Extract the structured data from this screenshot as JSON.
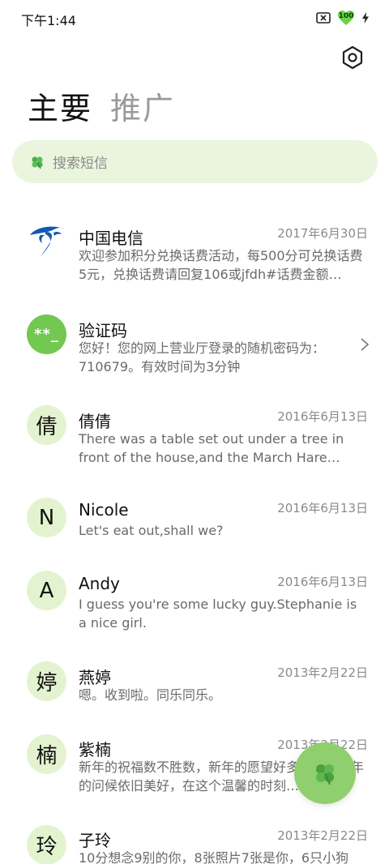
{
  "status_bar": {
    "time": "下午1:44",
    "battery_level": "100",
    "icons": [
      "sim-no-signal-icon",
      "battery-icon",
      "charging-bolt-icon"
    ]
  },
  "tabs": [
    {
      "label": "主要",
      "active": true
    },
    {
      "label": "推广",
      "active": false
    }
  ],
  "search": {
    "placeholder": "搜索短信",
    "icon": "clover-icon"
  },
  "conversations": [
    {
      "name": "中国电信",
      "date": "2017年6月30日",
      "preview": "欢迎参加积分兑换话费活动，每500分可兑换话费5元，兑换话费请回复106或jfdh#话费金额…",
      "avatar": "china-telecom-logo"
    },
    {
      "name": "验证码",
      "date": "",
      "preview": "您好！您的网上营业厅登录的随机密码为：710679。有效时间为3分钟",
      "avatar_text": "**_"
    },
    {
      "name": "倩倩",
      "date": "2016年6月13日",
      "preview": "There was a table set out under a tree in front of the house,and the March Hare and…",
      "avatar_text": "倩"
    },
    {
      "name": "Nicole",
      "date": "2016年6月13日",
      "preview": "Let's eat out,shall we?",
      "avatar_text": "N"
    },
    {
      "name": "Andy",
      "date": "2016年6月13日",
      "preview": "I guess you're some lucky guy.Stephanie is a nice girl.",
      "avatar_text": "A"
    },
    {
      "name": "燕婷",
      "date": "2013年2月22日",
      "preview": "嗯。收到啦。同乐同乐。",
      "avatar_text": "婷"
    },
    {
      "name": "紫楠",
      "date": "2013年2月22日",
      "preview": "新年的祝福数不胜数，新年的愿望好多好多，新年的问候依旧美好，在这个温馨的时刻…",
      "avatar_text": "楠"
    },
    {
      "name": "子玲",
      "date": "2013年2月22日",
      "preview": "10分想念9别的你，8张照片7张是你，6只小狗",
      "avatar_text": "玲"
    }
  ],
  "colors": {
    "accent_green": "#72c850",
    "avatar_bg": "#e3f3cf",
    "search_bg": "#eaf5dd",
    "fab_bg": "#8fcf6d",
    "telecom_blue": "#1258b3"
  }
}
